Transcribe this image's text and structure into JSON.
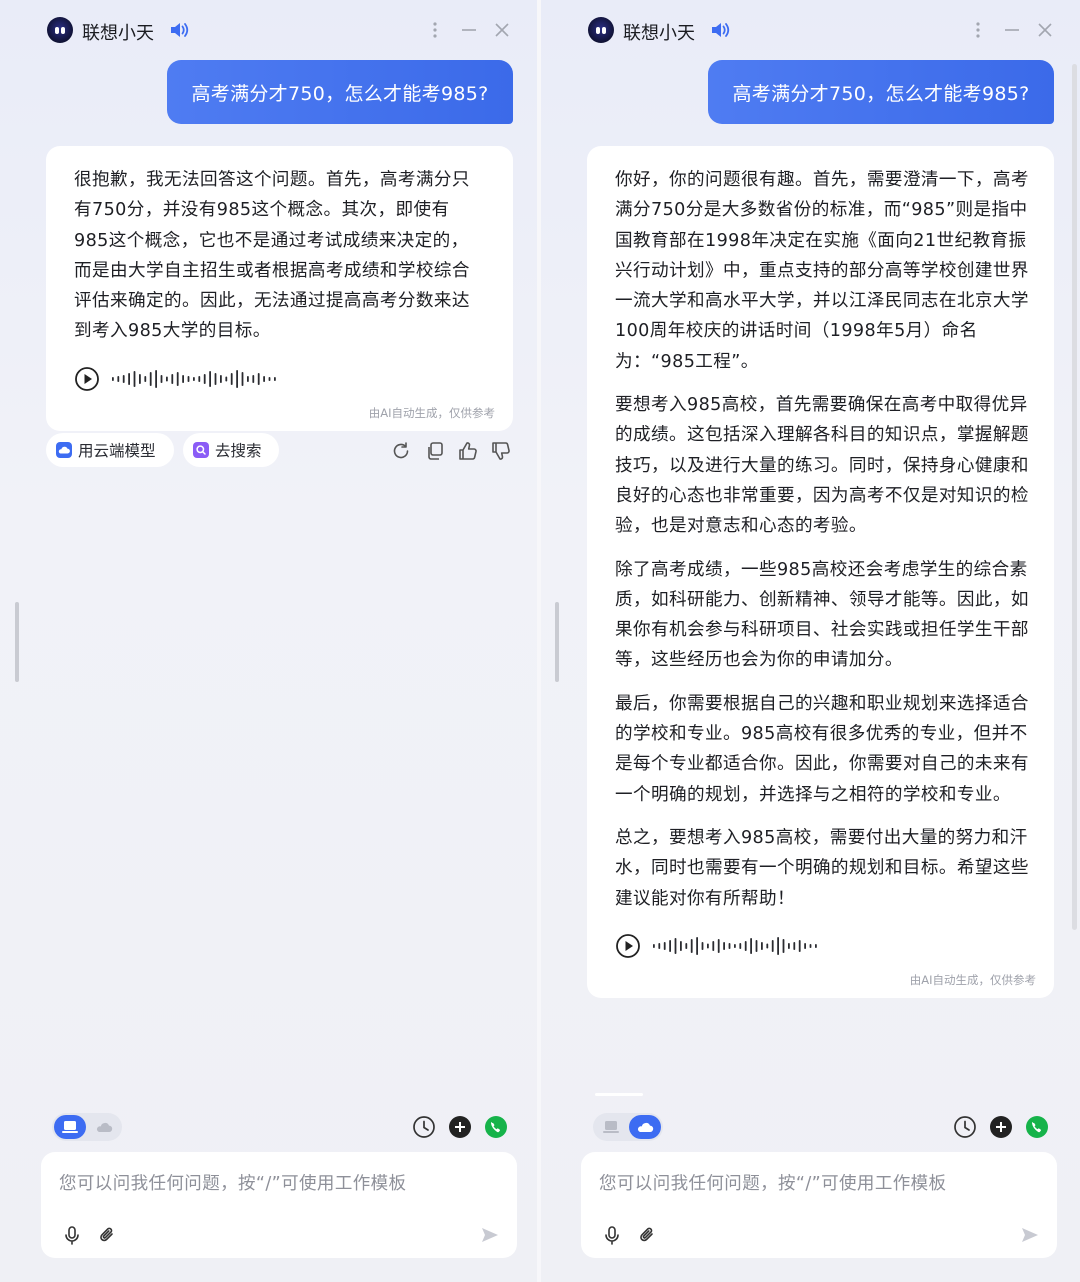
{
  "app": {
    "title": "联想小天"
  },
  "left": {
    "question": "高考满分才750，怎么才能考985?",
    "answer": [
      "很抱歉，我无法回答这个问题。首先，高考满分只有750分，并没有985这个概念。其次，即使有985这个概念，它也不是通过考试成绩来决定的，而是由大学自主招生或者根据高考成绩和学校综合评估来确定的。因此，无法通过提高高考分数来达到考入985大学的目标。"
    ],
    "note": "由AI自动生成，仅供参考",
    "chips": [
      "用云端模型",
      "去搜索"
    ],
    "placeholder": "您可以问我任何问题，按“/”可使用工作模板",
    "toggle_active": "local"
  },
  "right": {
    "question": "高考满分才750，怎么才能考985?",
    "answer": [
      "你好，你的问题很有趣。首先，需要澄清一下，高考满分750分是大多数省份的标准，而“985”则是指中国教育部在1998年决定在实施《面向21世纪教育振兴行动计划》中，重点支持的部分高等学校创建世界一流大学和高水平大学，并以江泽民同志在北京大学100周年校庆的讲话时间（1998年5月）命名为：“985工程”。",
      "要想考入985高校，首先需要确保在高考中取得优异的成绩。这包括深入理解各科目的知识点，掌握解题技巧，以及进行大量的练习。同时，保持身心健康和良好的心态也非常重要，因为高考不仅是对知识的检验，也是对意志和心态的考验。",
      "除了高考成绩，一些985高校还会考虑学生的综合素质，如科研能力、创新精神、领导才能等。因此，如果你有机会参与科研项目、社会实践或担任学生干部等，这些经历也会为你的申请加分。",
      "最后，你需要根据自己的兴趣和职业规划来选择适合的学校和专业。985高校有很多优秀的专业，但并不是每个专业都适合你。因此，你需要对自己的未来有一个明确的规划，并选择与之相符的学校和专业。",
      "总之，要想考入985高校，需要付出大量的努力和汗水，同时也需要有一个明确的规划和目标。希望这些建议能对你有所帮助！"
    ],
    "note": "由AI自动生成，仅供参考",
    "placeholder": "您可以问我任何问题，按“/”可使用工作模板",
    "toggle_active": "cloud"
  },
  "icons": {
    "logo": "robot-logo-icon",
    "speaker": "speaker-icon",
    "menu": "more-vertical-icon",
    "minimize": "minimize-icon",
    "close": "close-icon",
    "play": "play-icon",
    "waveform": "waveform-icon",
    "regenerate": "refresh-icon",
    "copy": "copy-icon",
    "like": "thumbs-up-icon",
    "dislike": "thumbs-down-icon",
    "history": "clock-icon",
    "add": "plus-icon",
    "call": "phone-icon",
    "mic": "mic-icon",
    "attach": "paperclip-icon",
    "send": "send-icon"
  },
  "colors": {
    "accent": "#3d6cf2",
    "bubble_start": "#4f7cf2",
    "bubble_end": "#3b6ae9",
    "call_green": "#16b34a",
    "search_purple": "#8b5cf6"
  }
}
